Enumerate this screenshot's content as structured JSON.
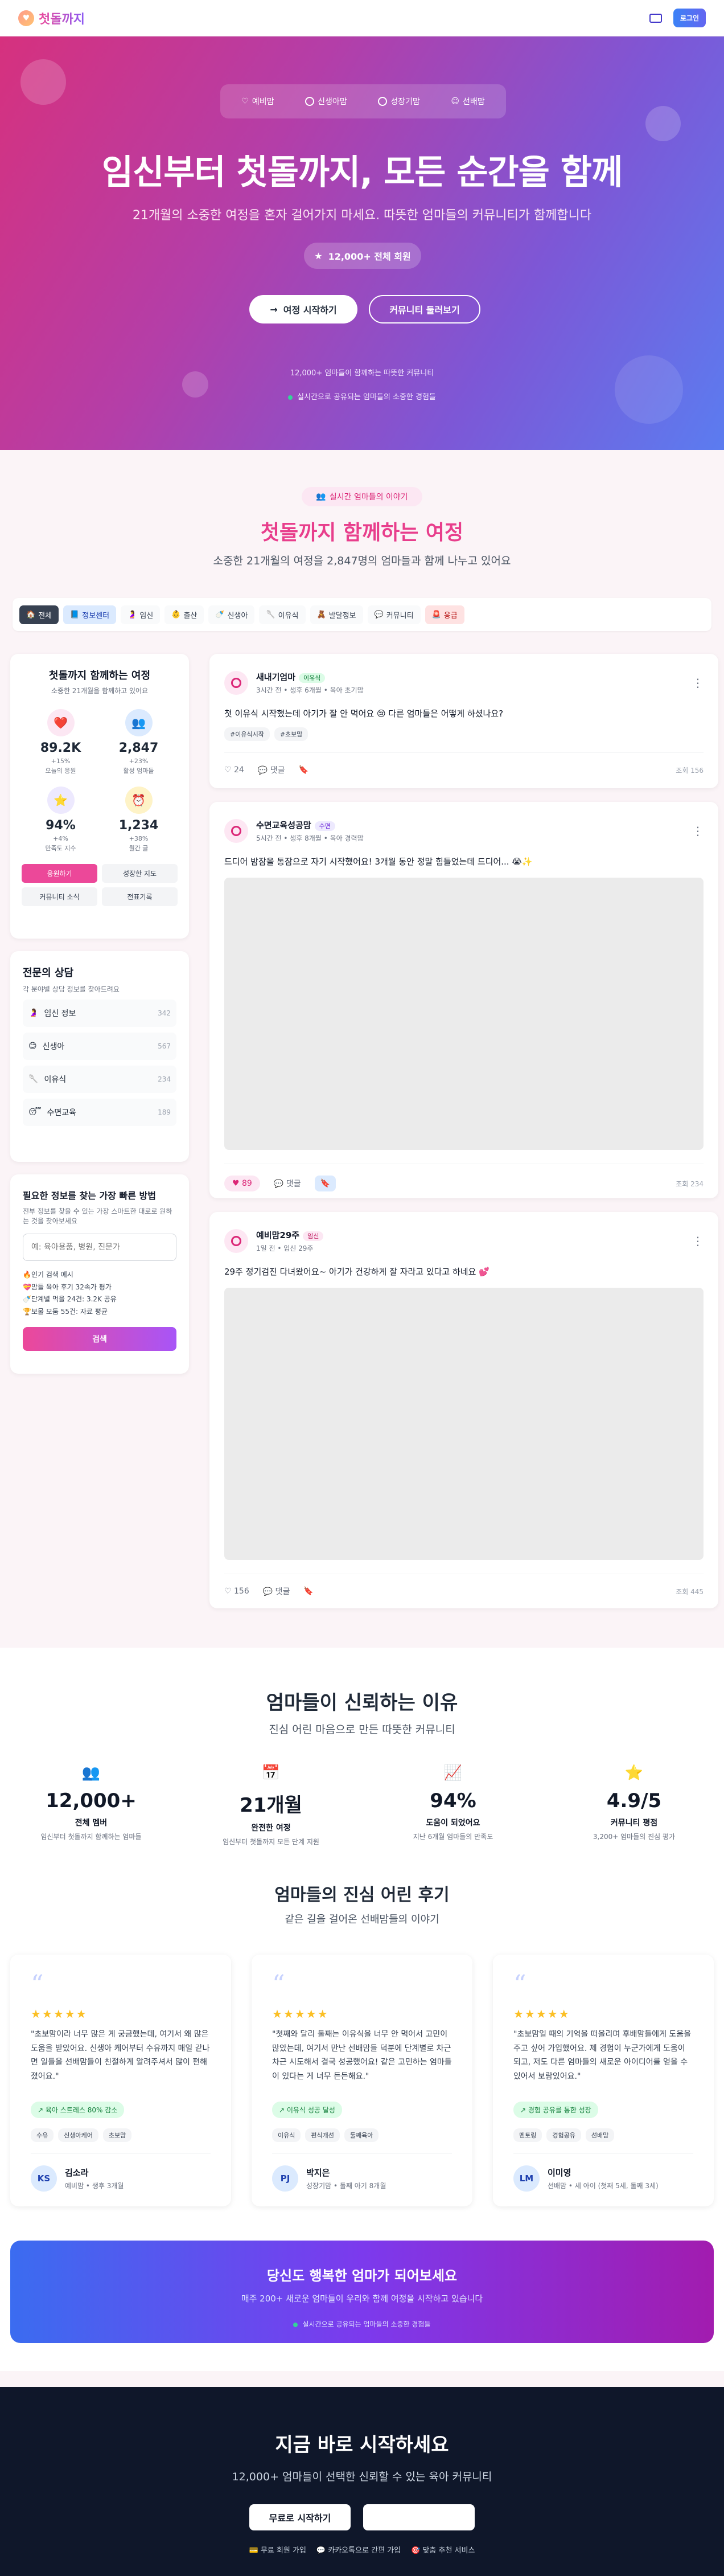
{
  "nav": {
    "brand": "첫돌까지",
    "login": "로그인"
  },
  "hero": {
    "tabs": [
      "예비맘",
      "신생아맘",
      "성장기맘",
      "선배맘"
    ],
    "title": "임신부터 첫돌까지, 모든 순간을 함께",
    "subtitle": "21개월의 소중한 여정을 혼자 걸어가지 마세요. 따뜻한 엄마들의 커뮤니티가 함께합니다",
    "pill": "12,000+ 전체 회원",
    "start_button": "여정 시작하기",
    "browse_button": "커뮤니티 둘러보기",
    "note1": "12,000+ 엄마들이 함께하는 따뜻한 커뮤니티",
    "note2": "실시간으로 공유되는 엄마들의 소중한 경험들"
  },
  "journey": {
    "badge": "실시간 엄마들의 이야기",
    "title": "첫돌까지 함께하는 여정",
    "subtitle": "소중한 21개월의 여정을 2,847명의 엄마들과 함께 나누고 있어요"
  },
  "categories": [
    {
      "icon": "🏠",
      "label": "전체"
    },
    {
      "icon": "📘",
      "label": "정보센터"
    },
    {
      "icon": "🤰",
      "label": "임신"
    },
    {
      "icon": "👶",
      "label": "출산"
    },
    {
      "icon": "🍼",
      "label": "신생아"
    },
    {
      "icon": "🥄",
      "label": "이유식"
    },
    {
      "icon": "🧸",
      "label": "발달정보"
    },
    {
      "icon": "💬",
      "label": "커뮤니티"
    },
    {
      "icon": "🚨",
      "label": "응급"
    }
  ],
  "sidebar": {
    "journey_title": "첫돌까지 함께하는 여정",
    "journey_sub": "소중한 21개월을 함께하고 있어요",
    "stats": [
      {
        "icon": "❤️",
        "value": "89.2K",
        "delta": "+15%",
        "label": "오늘의 응원",
        "bg": "#fce7f3"
      },
      {
        "icon": "👥",
        "value": "2,847",
        "delta": "+23%",
        "label": "활성 엄마들",
        "bg": "#dbeafe"
      },
      {
        "icon": "⭐",
        "value": "94%",
        "delta": "+4%",
        "label": "만족도 지수",
        "bg": "#ede9fe"
      },
      {
        "icon": "⏰",
        "value": "1,234",
        "delta": "+38%",
        "label": "월간 글",
        "bg": "#fef3c7"
      }
    ],
    "buttons": [
      "응원하기",
      "성장한 지도",
      "커뮤니티 소식",
      "전표기록"
    ],
    "expert_title": "전문의 상담",
    "expert_sub": "각 분야별 상담 정보를 찾아드려요",
    "experts": [
      {
        "icon": "🤰",
        "label": "임신 정보",
        "count": "342"
      },
      {
        "icon": "😊",
        "label": "신생아",
        "count": "567"
      },
      {
        "icon": "🥄",
        "label": "이유식",
        "count": "234"
      },
      {
        "icon": "😴",
        "label": "수면교육",
        "count": "189"
      }
    ],
    "search_title": "필요한 정보를 찾는 가장 빠른 방법",
    "search_sub": "전부 정보를 찾을 수 있는 가장 스마트한 대로로 원하는 것을 찾아보세요",
    "search_placeholder": "예: 육아용품, 병원, 진문가",
    "popular_head": "🔥인기 검색 예시",
    "popular": [
      "💝맘들 육아 후기 32속가 평가",
      "🍼단계별 먹을 24건: 3.2K 공유",
      "🏆보물 모둠 55건: 자료 평균"
    ],
    "search_button": "검색"
  },
  "posts": [
    {
      "name": "새내기엄마",
      "badge": "이유식",
      "meta": "3시간 전 • 생후 6개월 • 육아 초기맘",
      "body": "첫 이유식 시작했는데 아기가 잘 안 먹어요 😢 다른 엄마들은 어떻게 하셨나요?",
      "tags": [
        "#이유식시작",
        "#초보맘"
      ],
      "likes": "24",
      "comment": "댓글",
      "views": "조회 156"
    },
    {
      "name": "수면교육성공맘",
      "badge": "수면",
      "meta": "5시간 전 • 생후 8개월 • 육아 경력맘",
      "body": "드디어 밤잠을 통잠으로 자기 시작했어요! 3개월 동안 정말 힘들었는데 드디어... 😭✨",
      "tags": [],
      "likes": "89",
      "comment": "댓글",
      "views": "조회 234"
    },
    {
      "name": "예비맘29주",
      "badge": "임신",
      "meta": "1일 전 • 임신 29주",
      "body": "29주 정기검진 다녀왔어요~ 아기가 건강하게 잘 자라고 있다고 하네요 💕",
      "tags": [],
      "likes": "156",
      "comment": "댓글",
      "views": "조회 445"
    }
  ],
  "trust": {
    "title": "엄마들이 신뢰하는 이유",
    "subtitle": "진심 어린 마음으로 만든 따뜻한 커뮤니티",
    "stats": [
      {
        "icon": "👥",
        "value": "12,000+",
        "label": "전체 멤버",
        "desc": "임신부터 첫돌까지 함께하는 엄마들"
      },
      {
        "icon": "📅",
        "value": "21개월",
        "label": "완전한 여정",
        "desc": "임신부터 첫돌까지 모든 단계 지원"
      },
      {
        "icon": "📈",
        "value": "94%",
        "label": "도움이 되었어요",
        "desc": "지난 6개월 엄마들의 만족도"
      },
      {
        "icon": "⭐",
        "value": "4.9/5",
        "label": "커뮤니티 평점",
        "desc": "3,200+ 엄마들의 진심 평가"
      }
    ]
  },
  "reviews": {
    "title": "엄마들의 진심 어린 후기",
    "subtitle": "같은 길을 걸어온 선배맘들의 이야기",
    "items": [
      {
        "text": "\"초보맘이라 너무 많은 게 궁금했는데, 여기서 왜 많은 도움을 받았어요. 신생아 케어부터 수유까지 매일 같나면 일들을 선배맘들이 친절하게 알려주셔서 많이 편해졌어요.\"",
        "highlight": "육아 스트레스 80% 감소",
        "tags": [
          "수유",
          "신생아케어",
          "초보맘"
        ],
        "initials": "KS",
        "name": "김소라",
        "meta": "예비맘 • 생후 3개월"
      },
      {
        "text": "\"첫째와 달리 둘째는 이유식을 너무 안 먹어서 고민이 많았는데, 여기서 만난 선배맘들 덕분에 단계별로 차근차근 시도해서 결국 성공했어요! 같은 고민하는 엄마들이 있다는 게 너무 든든해요.\"",
        "highlight": "이유식 성공 달성",
        "tags": [
          "이유식",
          "편식개선",
          "둘째육아"
        ],
        "initials": "PJ",
        "name": "박지은",
        "meta": "성장기맘 • 둘째 아기 8개월"
      },
      {
        "text": "\"초보맘일 때의 기억을 떠올리며 후배맘들에게 도움을 주고 싶어 가입했어요. 제 경험이 누군가에게 도움이 되고, 저도 다른 엄마들의 새로운 아이디어를 얻을 수 있어서 보람있어요.\"",
        "highlight": "경험 공유를 통한 성장",
        "tags": [
          "멘토링",
          "경험공유",
          "선배맘"
        ],
        "initials": "LM",
        "name": "이미영",
        "meta": "선배맘 • 세 아이 (첫째 5세, 둘째 3세)"
      }
    ]
  },
  "promo": {
    "title": "당신도 행복한 엄마가 되어보세요",
    "subtitle": "매주 200+ 새로운 엄마들이 우리와 함께 여정을 시작하고 있습니다",
    "note": "실시간으로 공유되는 엄마들의 소중한 경험들"
  },
  "footer": {
    "title": "지금 바로 시작하세요",
    "subtitle": "12,000+ 엄마들이 선택한 신뢰할 수 있는 육아 커뮤니티",
    "cta": "무료로 시작하기",
    "notes": [
      "무료 회원 가입",
      "카카오톡으로 간편 가입",
      "맞춤 추천 서비스"
    ]
  }
}
